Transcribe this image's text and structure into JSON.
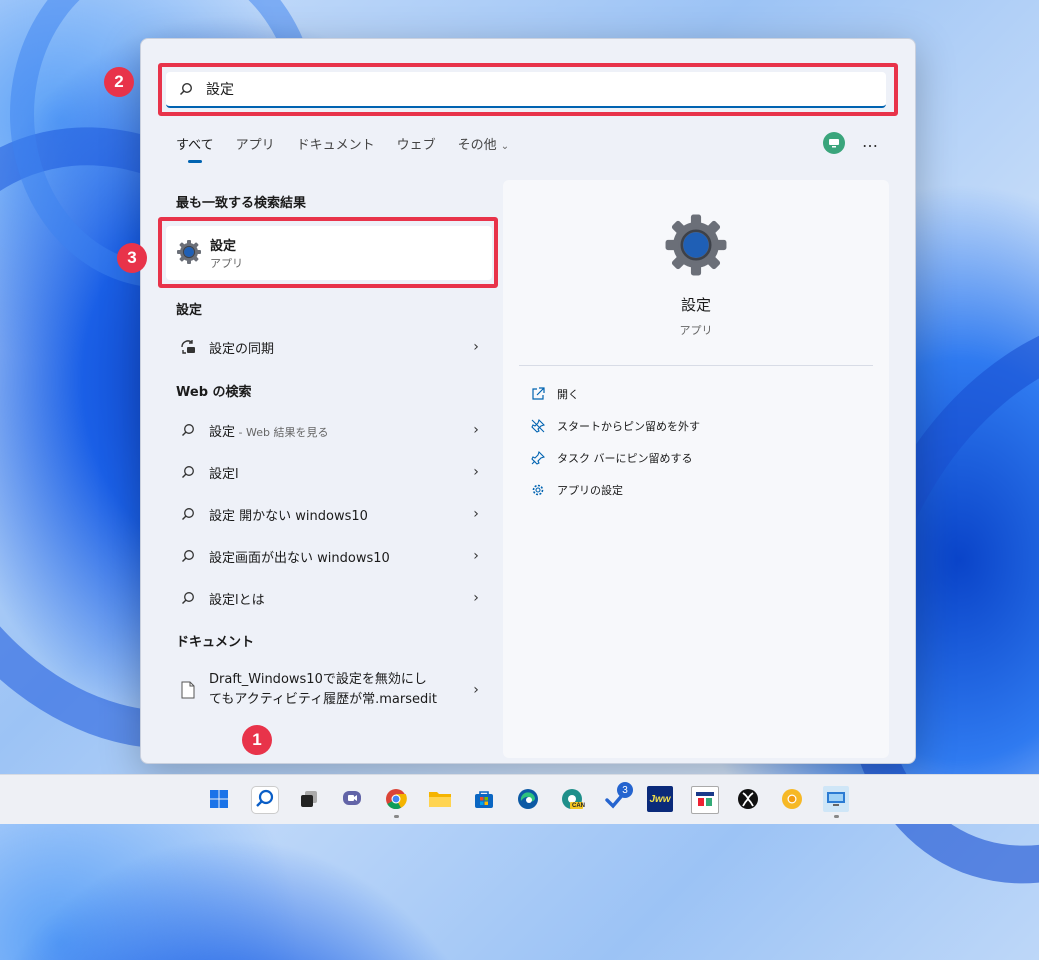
{
  "search": {
    "value": "設定"
  },
  "filters": {
    "tabs": [
      "すべて",
      "アプリ",
      "ドキュメント",
      "ウェブ"
    ],
    "other": "その他",
    "more": "…"
  },
  "best_match": {
    "heading": "最も一致する検索結果",
    "title": "設定",
    "subtitle": "アプリ"
  },
  "settings_section": {
    "heading": "設定",
    "items": [
      {
        "label": "設定の同期"
      }
    ]
  },
  "web_section": {
    "heading": "Web の検索",
    "first": {
      "label": "設定",
      "hint": " - Web 結果を見る"
    },
    "items": [
      {
        "label": "設定l"
      },
      {
        "label": "設定 開かない windows10"
      },
      {
        "label": "設定画面が出ない windows10"
      },
      {
        "label": "設定lとは"
      }
    ]
  },
  "documents_section": {
    "heading": "ドキュメント",
    "items": [
      {
        "line1": "Draft_Windows10で設定を無効にし",
        "line2": "てもアクティビティ履歴が常.marsedit"
      }
    ]
  },
  "preview": {
    "title": "設定",
    "subtitle": "アプリ",
    "actions": [
      {
        "icon": "open-icon",
        "label": "開く"
      },
      {
        "icon": "unpin-icon",
        "label": "スタートからピン留めを外す"
      },
      {
        "icon": "pin-icon",
        "label": "タスク バーにピン留めする"
      },
      {
        "icon": "gear-icon",
        "label": "アプリの設定"
      }
    ]
  },
  "annotations": {
    "badge1": "1",
    "badge2": "2",
    "badge3": "3"
  },
  "taskbar": {
    "todo_badge": "3",
    "jww_label": "Jww",
    "can_label": "CAN"
  },
  "colors": {
    "highlight": "#e8334a",
    "accent": "#0063b1"
  }
}
